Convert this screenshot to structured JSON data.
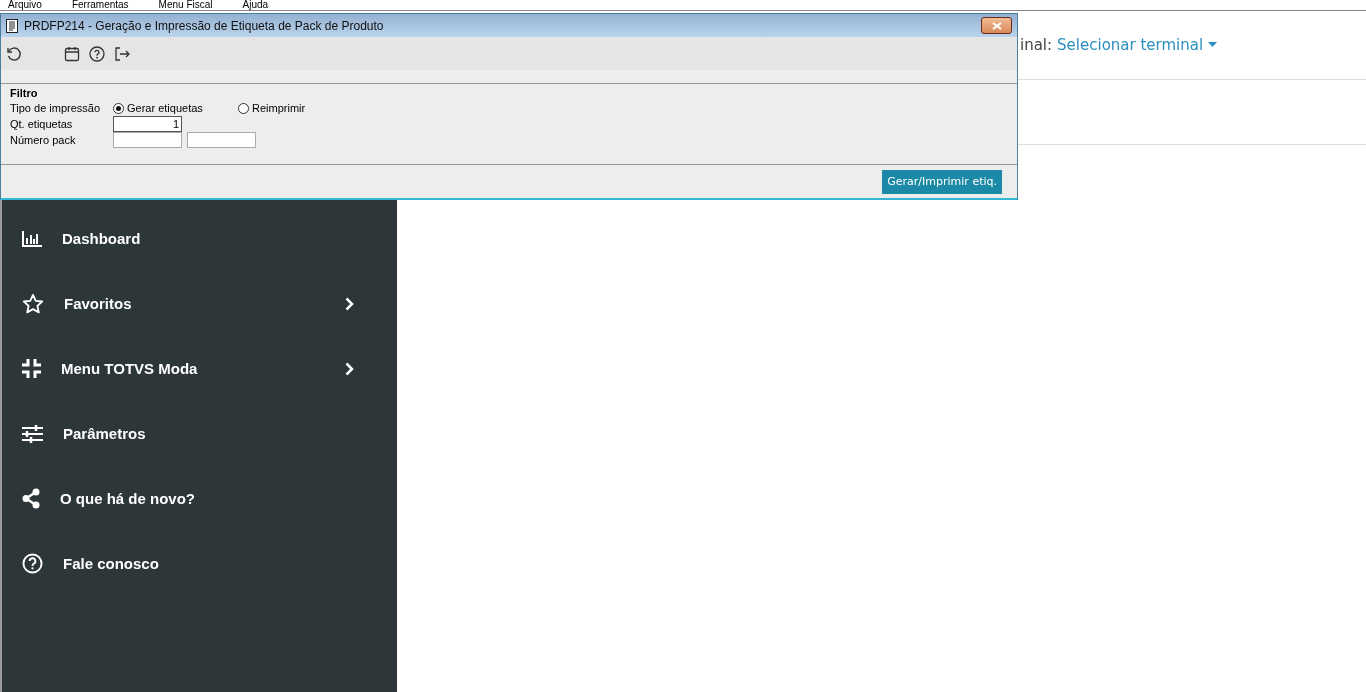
{
  "menu_bar": [
    "Arquivo",
    "Ferramentas",
    "Menu Fiscal",
    "Ajuda"
  ],
  "header": {
    "terminal_label": "inal:",
    "terminal_select": "Selecionar terminal"
  },
  "sidebar": {
    "items": [
      {
        "kind": "chart",
        "label": "Dashboard",
        "has_submenu": false
      },
      {
        "kind": "star",
        "label": "Favoritos",
        "has_submenu": true
      },
      {
        "kind": "compress",
        "label": "Menu TOTVS Moda",
        "has_submenu": true
      },
      {
        "kind": "sliders",
        "label": "Parâmetros",
        "has_submenu": false
      },
      {
        "kind": "share",
        "label": "O que há de novo?",
        "has_submenu": false
      },
      {
        "kind": "help",
        "label": "Fale conosco",
        "has_submenu": false
      }
    ]
  },
  "dialog": {
    "title": "PRDFP214 - Geração e Impressão de Etiqueta de Pack de Produto",
    "section": "Filtro",
    "print_type_label": "Tipo de impressão",
    "print_type_options": [
      {
        "label": "Gerar etiquetas",
        "selected": true
      },
      {
        "label": "Reimprimir",
        "selected": false
      }
    ],
    "qty_label": "Qt. etiquetas",
    "qty_value": "1",
    "pack_label": "Número pack",
    "button": "Gerar/Imprimir etiq."
  }
}
